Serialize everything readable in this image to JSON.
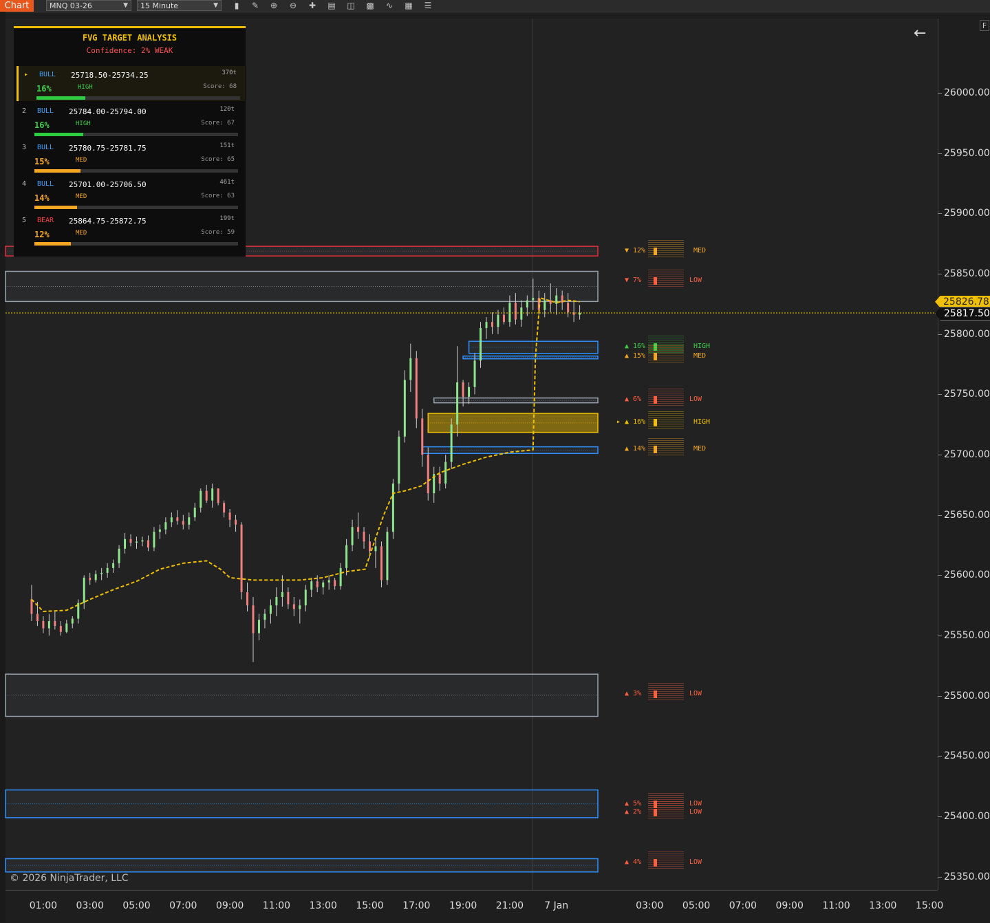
{
  "toolbar": {
    "tab_label": "Chart",
    "instrument": "MNQ 03-26",
    "interval": "15 Minute",
    "icons": [
      "bar-type-icon",
      "draw-tool-icon",
      "zoom-in-icon",
      "zoom-out-icon",
      "crosshair-icon",
      "properties-icon",
      "template-icon",
      "indicators-icon",
      "strategies-icon",
      "data-box-icon",
      "order-icon"
    ]
  },
  "panel": {
    "title": "FVG TARGET ANALYSIS",
    "confidence": "Confidence: 2% WEAK",
    "rows": [
      {
        "rank": "▸",
        "dir": "BULL",
        "range": "25718.50-25734.25",
        "ticks": "370t",
        "prob": "16%",
        "level": "HIGH",
        "score": "Score: 68",
        "fill": 0.16
      },
      {
        "rank": "2",
        "dir": "BULL",
        "range": "25784.00-25794.00",
        "ticks": "120t",
        "prob": "16%",
        "level": "HIGH",
        "score": "Score: 67",
        "fill": 0.16
      },
      {
        "rank": "3",
        "dir": "BULL",
        "range": "25780.75-25781.75",
        "ticks": "151t",
        "prob": "15%",
        "level": "MED",
        "score": "Score: 65",
        "fill": 0.15
      },
      {
        "rank": "4",
        "dir": "BULL",
        "range": "25701.00-25706.50",
        "ticks": "461t",
        "prob": "14%",
        "level": "MED",
        "score": "Score: 63",
        "fill": 0.14
      },
      {
        "rank": "5",
        "dir": "BEAR",
        "range": "25864.75-25872.75",
        "ticks": "199t",
        "prob": "12%",
        "level": "MED",
        "score": "Score: 59",
        "fill": 0.12
      }
    ]
  },
  "zone_labels": [
    {
      "prefix": "▼",
      "prob": "12%",
      "level": "MED",
      "price": 25868,
      "color": "#f5a623"
    },
    {
      "prefix": "▼",
      "prob": "7%",
      "level": "LOW",
      "price": 25844,
      "color": "#ff6040"
    },
    {
      "prefix": "▲",
      "prob": "16%",
      "level": "HIGH",
      "price": 25789,
      "color": "#3ecf4a"
    },
    {
      "prefix": "▲",
      "prob": "15%",
      "level": "MED",
      "price": 25781,
      "color": "#f5a623"
    },
    {
      "prefix": "▲",
      "prob": "6%",
      "level": "LOW",
      "price": 25745,
      "color": "#ff6040"
    },
    {
      "prefix": "▸ ▲",
      "prob": "16%",
      "level": "HIGH",
      "price": 25726,
      "color": "#f0c000"
    },
    {
      "prefix": "▲",
      "prob": "14%",
      "level": "MED",
      "price": 25704,
      "color": "#f5a623"
    },
    {
      "prefix": "▲",
      "prob": "3%",
      "level": "LOW",
      "price": 25501,
      "color": "#ff6040"
    },
    {
      "prefix": "▲",
      "prob": "5%",
      "level": "LOW",
      "price": 25410,
      "color": "#ff6040"
    },
    {
      "prefix": "▲",
      "prob": "2%",
      "level": "LOW",
      "price": 25403,
      "color": "#ff6040"
    },
    {
      "prefix": "▲",
      "prob": "4%",
      "level": "LOW",
      "price": 25361,
      "color": "#ff6040"
    }
  ],
  "chart_data": {
    "type": "candlestick",
    "instrument": "MNQ 03-26",
    "interval": "15 Minute",
    "ylim": [
      25320,
      26050
    ],
    "y_ticks": [
      "26000.00",
      "25950.00",
      "25900.00",
      "25850.00",
      "25800.00",
      "25750.00",
      "25700.00",
      "25650.00",
      "25600.00",
      "25550.00",
      "25500.00",
      "25450.00",
      "25400.00",
      "25350.00"
    ],
    "y_tick_values": [
      26000,
      25950,
      25900,
      25850,
      25800,
      25750,
      25700,
      25650,
      25600,
      25550,
      25500,
      25450,
      25400,
      25350
    ],
    "x_ticks": [
      "01:00",
      "03:00",
      "05:00",
      "07:00",
      "09:00",
      "11:00",
      "13:00",
      "15:00",
      "17:00",
      "19:00",
      "21:00",
      "7 Jan",
      "03:00",
      "05:00",
      "07:00",
      "09:00",
      "11:00",
      "13:00",
      "15:00"
    ],
    "x_tick_hours": [
      1,
      3,
      5,
      7,
      9,
      11,
      13,
      15,
      17,
      19,
      21,
      23,
      27,
      29,
      31,
      33,
      35,
      37,
      39
    ],
    "last_price": "25817.50",
    "last_price_value": 25817.5,
    "ma_label": "25826.78",
    "ma_label_value": 25826.78,
    "zones": [
      {
        "type": "bear",
        "from": 25864.75,
        "to": 25872.75,
        "color": "#e0303a",
        "start_hour": 0
      },
      {
        "type": "neutral",
        "from": 25827,
        "to": 25852,
        "color": "#9aa3ad",
        "start_hour": 0
      },
      {
        "type": "bull",
        "from": 25784,
        "to": 25794,
        "color": "#2f8fff",
        "start_hour": 19.25
      },
      {
        "type": "bull",
        "from": 25780.75,
        "to": 25781.75,
        "color": "#2f8fff",
        "start_hour": 19.0
      },
      {
        "type": "neutral",
        "from": 25743,
        "to": 25747,
        "color": "#9aa3ad",
        "start_hour": 17.75
      },
      {
        "type": "target",
        "from": 25718.5,
        "to": 25734.25,
        "color": "#f0c000",
        "start_hour": 17.5
      },
      {
        "type": "bull",
        "from": 25701,
        "to": 25706.5,
        "color": "#2f8fff",
        "start_hour": 17.25
      },
      {
        "type": "neutral",
        "from": 25483,
        "to": 25518,
        "color": "#9aa3ad",
        "start_hour": 0
      },
      {
        "type": "bull",
        "from": 25399,
        "to": 25422,
        "color": "#2f8fff",
        "start_hour": 0
      },
      {
        "type": "bull",
        "from": 25354,
        "to": 25365,
        "color": "#2f8fff",
        "start_hour": 0
      }
    ],
    "candles_start_hour": 0.5,
    "candle_step_hours": 0.25,
    "candles": [
      [
        25580,
        25592,
        25562,
        25568
      ],
      [
        25568,
        25578,
        25558,
        25562
      ],
      [
        25562,
        25566,
        25552,
        25556
      ],
      [
        25556,
        25568,
        25550,
        25562
      ],
      [
        25562,
        25570,
        25555,
        25558
      ],
      [
        25558,
        25562,
        25550,
        25553
      ],
      [
        25553,
        25563,
        25552,
        25560
      ],
      [
        25560,
        25566,
        25556,
        25564
      ],
      [
        25564,
        25580,
        25560,
        25577
      ],
      [
        25577,
        25600,
        25572,
        25598
      ],
      [
        25598,
        25602,
        25592,
        25596
      ],
      [
        25596,
        25604,
        25594,
        25601
      ],
      [
        25601,
        25606,
        25596,
        25602
      ],
      [
        25602,
        25610,
        25598,
        25606
      ],
      [
        25606,
        25613,
        25602,
        25610
      ],
      [
        25610,
        25625,
        25606,
        25622
      ],
      [
        25622,
        25635,
        25618,
        25630
      ],
      [
        25630,
        25634,
        25624,
        25627
      ],
      [
        25627,
        25632,
        25622,
        25628
      ],
      [
        25628,
        25632,
        25624,
        25629
      ],
      [
        25629,
        25633,
        25620,
        25623
      ],
      [
        25623,
        25640,
        25620,
        25636
      ],
      [
        25636,
        25642,
        25630,
        25638
      ],
      [
        25638,
        25648,
        25634,
        25644
      ],
      [
        25644,
        25652,
        25640,
        25648
      ],
      [
        25648,
        25654,
        25642,
        25645
      ],
      [
        25645,
        25650,
        25638,
        25642
      ],
      [
        25642,
        25652,
        25638,
        25648
      ],
      [
        25648,
        25660,
        25645,
        25656
      ],
      [
        25656,
        25672,
        25652,
        25670
      ],
      [
        25670,
        25675,
        25660,
        25662
      ],
      [
        25662,
        25676,
        25656,
        25672
      ],
      [
        25672,
        25670,
        25658,
        25660
      ],
      [
        25660,
        25662,
        25648,
        25652
      ],
      [
        25652,
        25655,
        25640,
        25646
      ],
      [
        25646,
        25650,
        25636,
        25642
      ],
      [
        25642,
        25644,
        25580,
        25586
      ],
      [
        25586,
        25594,
        25570,
        25575
      ],
      [
        25575,
        25582,
        25528,
        25552
      ],
      [
        25552,
        25568,
        25546,
        25563
      ],
      [
        25563,
        25572,
        25556,
        25568
      ],
      [
        25568,
        25580,
        25560,
        25575
      ],
      [
        25575,
        25590,
        25566,
        25582
      ],
      [
        25582,
        25600,
        25574,
        25586
      ],
      [
        25586,
        25590,
        25572,
        25576
      ],
      [
        25576,
        25582,
        25566,
        25572
      ],
      [
        25572,
        25580,
        25560,
        25575
      ],
      [
        25575,
        25592,
        25570,
        25588
      ],
      [
        25588,
        25598,
        25582,
        25595
      ],
      [
        25595,
        25600,
        25586,
        25590
      ],
      [
        25590,
        25596,
        25584,
        25594
      ],
      [
        25594,
        25600,
        25588,
        25596
      ],
      [
        25596,
        25598,
        25588,
        25591
      ],
      [
        25591,
        25610,
        25588,
        25606
      ],
      [
        25606,
        25630,
        25600,
        25625
      ],
      [
        25625,
        25646,
        25620,
        25640
      ],
      [
        25640,
        25652,
        25630,
        25636
      ],
      [
        25636,
        25640,
        25622,
        25628
      ],
      [
        25628,
        25634,
        25614,
        25620
      ],
      [
        25620,
        25630,
        25606,
        25624
      ],
      [
        25624,
        25628,
        25590,
        25596
      ],
      [
        25596,
        25640,
        25592,
        25636
      ],
      [
        25636,
        25680,
        25630,
        25676
      ],
      [
        25676,
        25720,
        25670,
        25715
      ],
      [
        25715,
        25770,
        25710,
        25762
      ],
      [
        25762,
        25792,
        25752,
        25780
      ],
      [
        25780,
        25786,
        25722,
        25730
      ],
      [
        25730,
        25738,
        25690,
        25700
      ],
      [
        25700,
        25706,
        25662,
        25668
      ],
      [
        25668,
        25690,
        25660,
        25684
      ],
      [
        25684,
        25690,
        25670,
        25676
      ],
      [
        25676,
        25700,
        25672,
        25694
      ],
      [
        25694,
        25730,
        25688,
        25725
      ],
      [
        25725,
        25790,
        25715,
        25760
      ],
      [
        25760,
        25762,
        25740,
        25748
      ],
      [
        25748,
        25760,
        25742,
        25756
      ],
      [
        25756,
        25784,
        25750,
        25778
      ],
      [
        25778,
        25810,
        25772,
        25805
      ],
      [
        25805,
        25814,
        25796,
        25810
      ],
      [
        25810,
        25818,
        25800,
        25806
      ],
      [
        25806,
        25820,
        25800,
        25816
      ],
      [
        25816,
        25822,
        25808,
        25810
      ],
      [
        25810,
        25832,
        25806,
        25826
      ],
      [
        25826,
        25834,
        25808,
        25812
      ],
      [
        25812,
        25828,
        25806,
        25822
      ],
      [
        25822,
        25832,
        25815,
        25828
      ],
      [
        25828,
        25846,
        25820,
        25830
      ],
      [
        25830,
        25836,
        25816,
        25820
      ],
      [
        25820,
        25834,
        25814,
        25828
      ],
      [
        25828,
        25842,
        25818,
        25825
      ],
      [
        25825,
        25838,
        25816,
        25832
      ],
      [
        25832,
        25836,
        25820,
        25826
      ],
      [
        25826,
        25834,
        25814,
        25818
      ],
      [
        25818,
        25828,
        25810,
        25816
      ],
      [
        25816,
        25824,
        25812,
        25817.5
      ]
    ],
    "ma": [
      [
        0.5,
        25580
      ],
      [
        1,
        25570
      ],
      [
        2,
        25571
      ],
      [
        3,
        25580
      ],
      [
        4,
        25588
      ],
      [
        5,
        25595
      ],
      [
        6,
        25605
      ],
      [
        7,
        25610
      ],
      [
        8,
        25612
      ],
      [
        8.6,
        25605
      ],
      [
        9,
        25598
      ],
      [
        10,
        25596
      ],
      [
        11,
        25596
      ],
      [
        12,
        25596
      ],
      [
        13,
        25598
      ],
      [
        14,
        25603
      ],
      [
        14.8,
        25605
      ],
      [
        15.2,
        25628
      ],
      [
        15.6,
        25650
      ],
      [
        16,
        25668
      ],
      [
        16.5,
        25670
      ],
      [
        17.2,
        25674
      ],
      [
        18,
        25685
      ],
      [
        19,
        25692
      ],
      [
        20,
        25698
      ],
      [
        21,
        25702
      ],
      [
        22,
        25704
      ],
      [
        22.1,
        25780
      ],
      [
        22.3,
        25830
      ],
      [
        23,
        25826
      ],
      [
        23.5,
        25828
      ],
      [
        24,
        25826.78
      ]
    ]
  }
}
